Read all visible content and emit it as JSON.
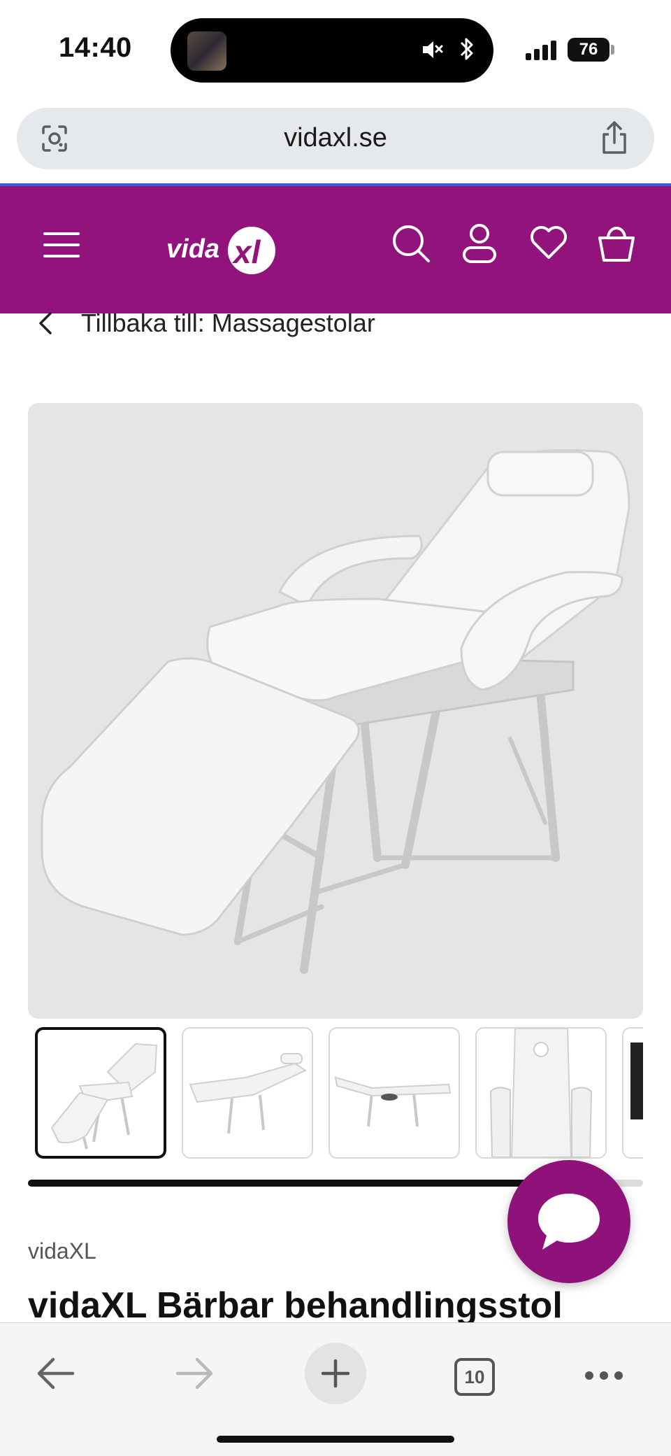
{
  "status_bar": {
    "time": "14:40",
    "battery": "76",
    "icons": [
      "avatar-thumbnail",
      "mute-icon",
      "bluetooth-icon",
      "signal-icon",
      "battery-icon"
    ]
  },
  "browser": {
    "url": "vidaxl.se",
    "left_icon": "lens-icon",
    "right_icon": "share-icon"
  },
  "site_header": {
    "brand_color": "#93137c",
    "logo_text": "vidaXL",
    "icons": [
      "menu-icon",
      "search-icon",
      "account-icon",
      "wishlist-icon",
      "cart-icon"
    ]
  },
  "back_link": {
    "label": "Tillbaka till: Massagestolar"
  },
  "gallery": {
    "main_image": "portable-treatment-chair-white",
    "thumbnails": [
      "chair-angle-view",
      "chair-flat-side-view",
      "chair-folded-side-view",
      "chair-top-view",
      "chair-dark-partial"
    ],
    "active_index": 0,
    "scroll_progress": 0.82
  },
  "chat": {
    "icon": "chat-bubble-icon"
  },
  "product": {
    "brand": "vidaXL",
    "title": "vidaXL Bärbar behandlingsstol"
  },
  "toolbar": {
    "tabs_count": "10",
    "icons": [
      "back-arrow-icon",
      "forward-arrow-icon",
      "new-tab-plus-icon",
      "tabs-icon",
      "more-icon"
    ]
  }
}
